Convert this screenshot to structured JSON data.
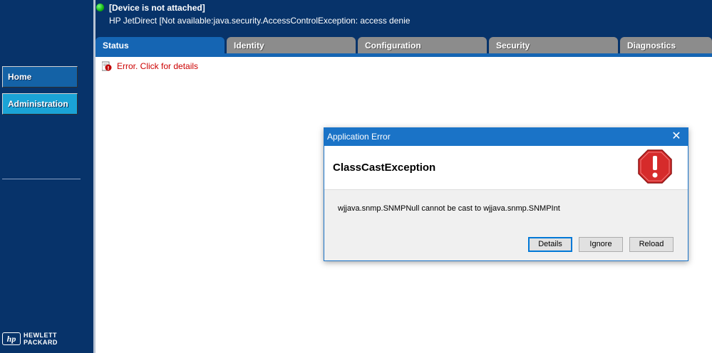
{
  "header": {
    "device_status": "[Device is not attached]",
    "device_info": "HP JetDirect [Not available:java.security.AccessControlException: access denie"
  },
  "sidebar": {
    "items": [
      {
        "label": "Home"
      },
      {
        "label": "Administration"
      }
    ],
    "logo": {
      "mark": "hp",
      "line1": "HEWLETT",
      "line2": "PACKARD"
    }
  },
  "tabs": [
    {
      "label": "Status",
      "active": true
    },
    {
      "label": "Identity",
      "active": false
    },
    {
      "label": "Configuration",
      "active": false
    },
    {
      "label": "Security",
      "active": false
    },
    {
      "label": "Diagnostics",
      "active": false
    }
  ],
  "content": {
    "error_link": "Error. Click for details"
  },
  "dialog": {
    "title": "Application Error",
    "close_glyph": "✕",
    "exception": "ClassCastException",
    "message": "wjjava.snmp.SNMPNull cannot be cast to wjjava.snmp.SNMPInt",
    "buttons": {
      "details": "Details",
      "ignore": "Ignore",
      "reload": "Reload"
    },
    "icon": "stop-error-icon"
  },
  "colors": {
    "navy": "#07336a",
    "tab_active": "#1565b3",
    "tab_inactive": "#8c8c8c",
    "error_text": "#cc0000",
    "dialog_titlebar": "#1a73c7",
    "stop_red": "#d62b2b"
  }
}
